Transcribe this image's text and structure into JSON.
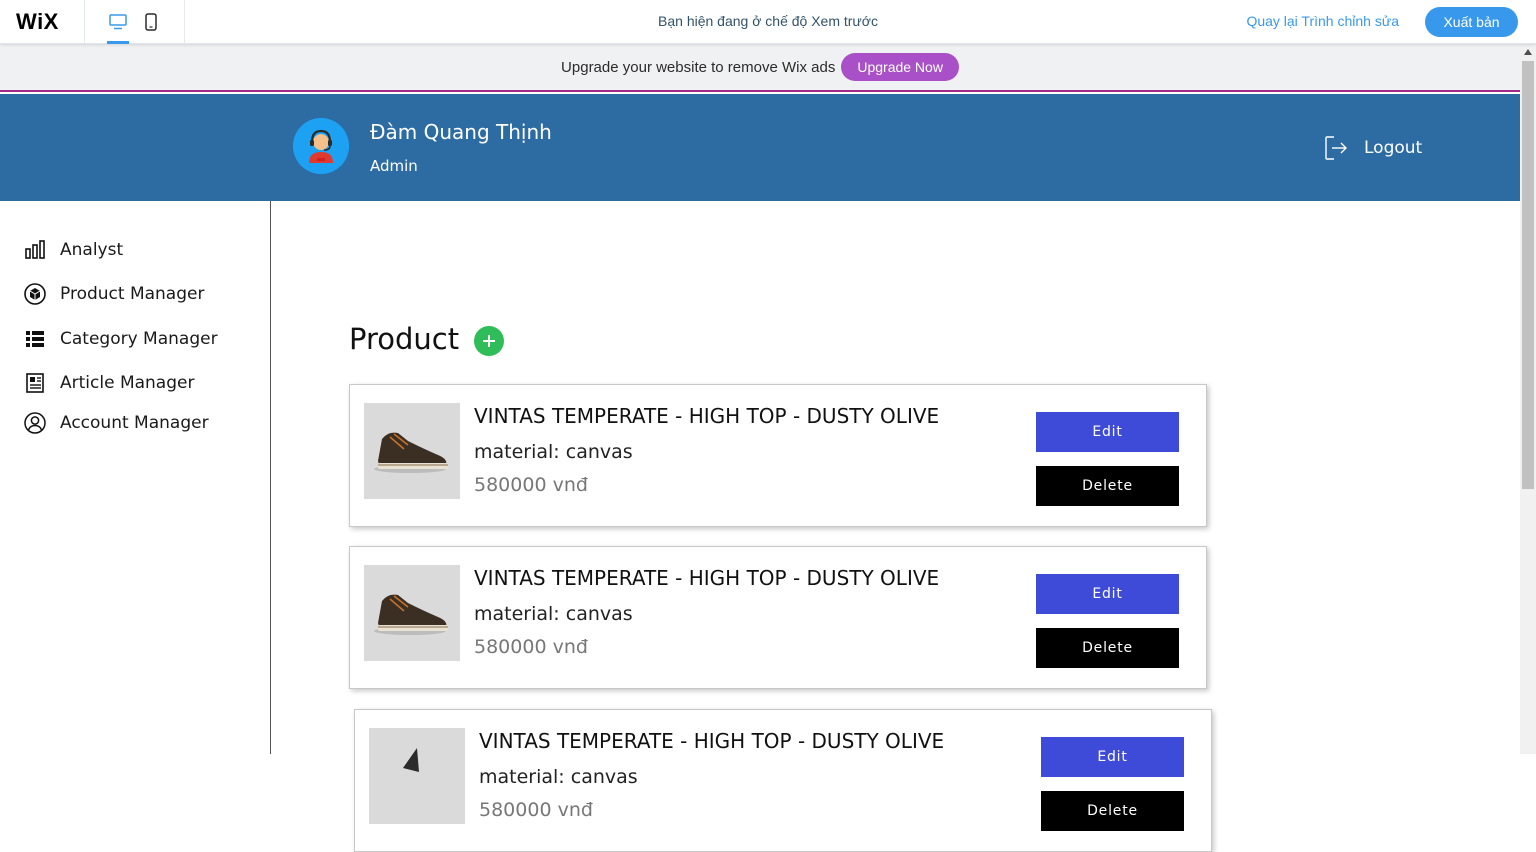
{
  "wix": {
    "logo": "WiX",
    "preview_text": "Bạn hiện đang ở chế độ Xem trước",
    "back_label": "Quay lại Trình chỉnh sửa",
    "publish_label": "Xuất bản",
    "accent_color": "#3899ec"
  },
  "ad": {
    "text": "Upgrade your website to remove Wix ads",
    "button_label": "Upgrade Now",
    "button_color": "#a950c8"
  },
  "header": {
    "user_name": "Đàm Quang Thịnh",
    "user_role": "Admin",
    "logout_label": "Logout",
    "background_color": "#2d6ca3"
  },
  "sidebar": {
    "items": [
      {
        "label": "Analyst",
        "icon": "bar-chart-icon"
      },
      {
        "label": "Product Manager",
        "icon": "cube-icon"
      },
      {
        "label": "Category Manager",
        "icon": "list-icon"
      },
      {
        "label": "Article Manager",
        "icon": "newspaper-icon"
      },
      {
        "label": "Account Manager",
        "icon": "user-circle-icon"
      }
    ]
  },
  "main": {
    "title": "Product",
    "add_icon": "plus-icon",
    "products": [
      {
        "name": "VINTAS TEMPERATE - HIGH TOP - DUSTY OLIVE",
        "material": "material: canvas",
        "price": "580000 vnđ",
        "edit_label": "Edit",
        "delete_label": "Delete"
      },
      {
        "name": "VINTAS TEMPERATE - HIGH TOP - DUSTY OLIVE",
        "material": "material: canvas",
        "price": "580000 vnđ",
        "edit_label": "Edit",
        "delete_label": "Delete"
      },
      {
        "name": "VINTAS TEMPERATE - HIGH TOP - DUSTY OLIVE",
        "material": "material: canvas",
        "price": "580000 vnđ",
        "edit_label": "Edit",
        "delete_label": "Delete"
      }
    ]
  }
}
